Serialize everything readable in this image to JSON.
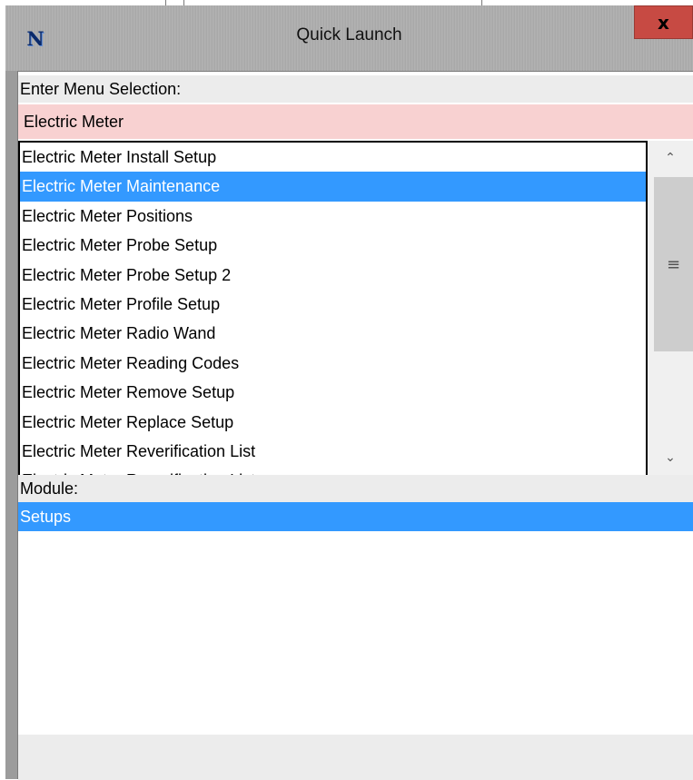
{
  "window": {
    "title": "Quick Launch",
    "app_icon_glyph": "N",
    "close_glyph": "x"
  },
  "menu": {
    "label": "Enter Menu Selection:",
    "input_value": "Electric Meter",
    "items": [
      "Electric Meter Install Setup",
      "Electric Meter Maintenance",
      "Electric Meter Positions",
      "Electric Meter Probe Setup",
      "Electric Meter Probe Setup 2",
      "Electric Meter Profile Setup",
      "Electric Meter Radio Wand",
      "Electric Meter Reading Codes",
      "Electric Meter Remove Setup",
      "Electric Meter Replace Setup",
      "Electric Meter Reverification List",
      "Electric Meter Reverification List"
    ],
    "selected_index": 1
  },
  "module": {
    "label": "Module:",
    "value": "Setups"
  },
  "colors": {
    "selection_blue": "#3399ff",
    "input_pink": "#f8d1d1",
    "close_red": "#c74a43"
  }
}
